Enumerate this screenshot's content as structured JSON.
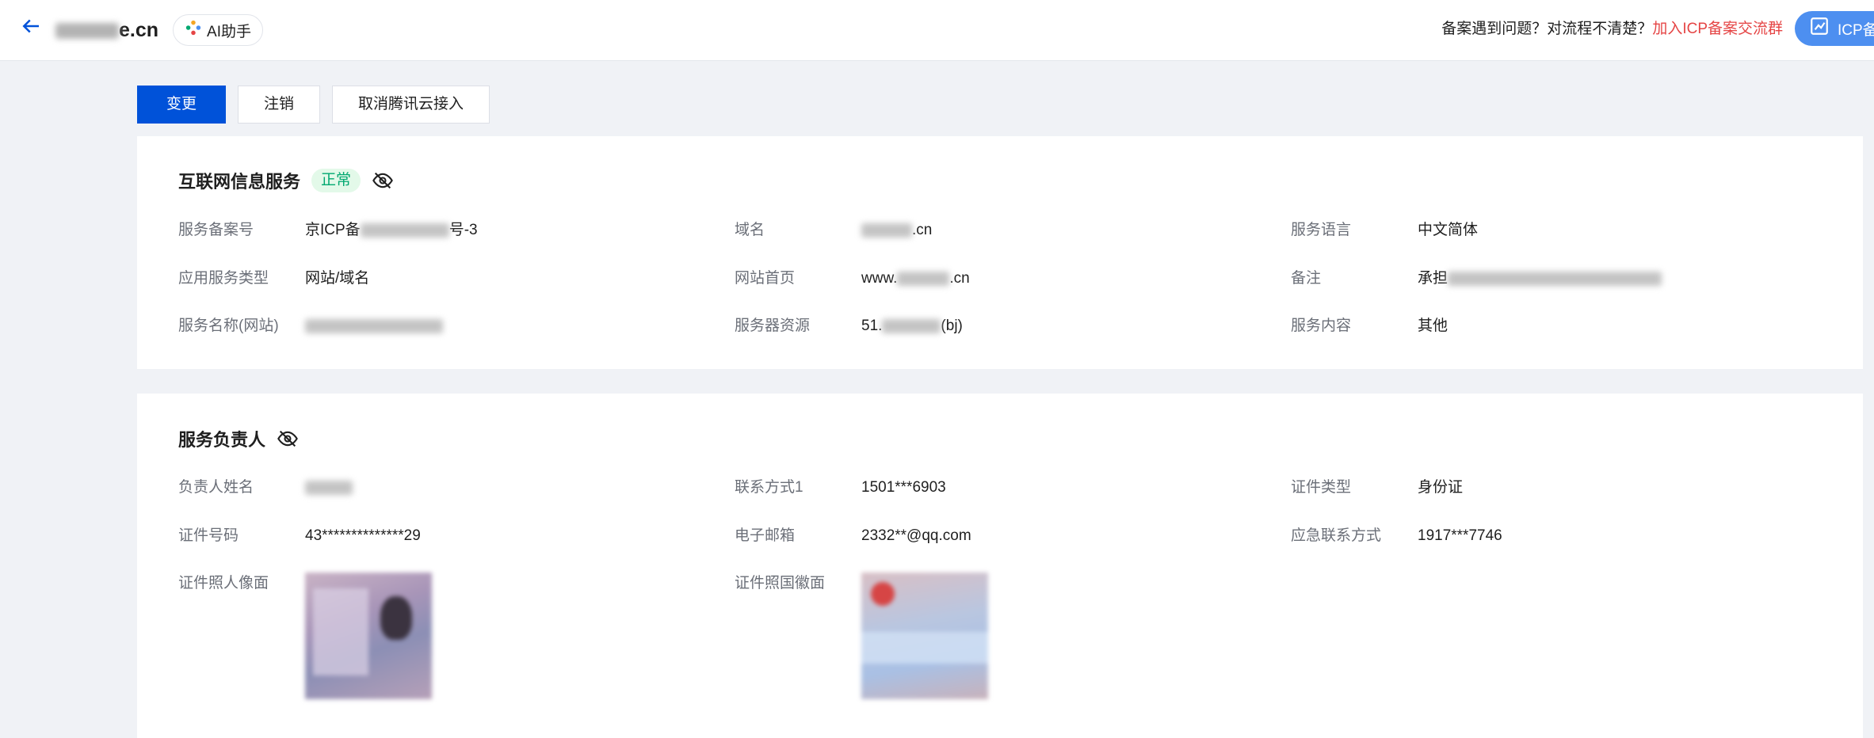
{
  "header": {
    "domain_suffix": "e.cn",
    "ai_label": "AI助手",
    "help_text": "备案遇到问题？对流程不清楚？",
    "help_link": "加入ICP备案交流群",
    "icp_label": "ICP备"
  },
  "actions": {
    "change": "变更",
    "cancel": "注销",
    "unlink": "取消腾讯云接入"
  },
  "service": {
    "title": "互联网信息服务",
    "status": "正常",
    "fields": {
      "record_no_label": "服务备案号",
      "record_no_prefix": "京ICP备",
      "record_no_suffix": "号-3",
      "domain_label": "域名",
      "domain_suffix": ".cn",
      "language_label": "服务语言",
      "language_value": "中文简体",
      "app_type_label": "应用服务类型",
      "app_type_value": "网站/域名",
      "homepage_label": "网站首页",
      "homepage_prefix": "www.",
      "homepage_suffix": ".cn",
      "remark_label": "备注",
      "remark_prefix": "承担",
      "name_label": "服务名称(网站)",
      "server_label": "服务器资源",
      "server_prefix": "51.",
      "server_suffix": "(bj)",
      "content_label": "服务内容",
      "content_value": "其他"
    }
  },
  "owner": {
    "title": "服务负责人",
    "fields": {
      "name_label": "负责人姓名",
      "contact_label": "联系方式1",
      "contact_value": "1501***6903",
      "cert_type_label": "证件类型",
      "cert_type_value": "身份证",
      "cert_no_label": "证件号码",
      "cert_no_value": "43**************29",
      "email_label": "电子邮箱",
      "email_value": "2332**@qq.com",
      "emergency_label": "应急联系方式",
      "emergency_value": "1917***7746",
      "photo_front_label": "证件照人像面",
      "photo_back_label": "证件照国徽面"
    }
  }
}
